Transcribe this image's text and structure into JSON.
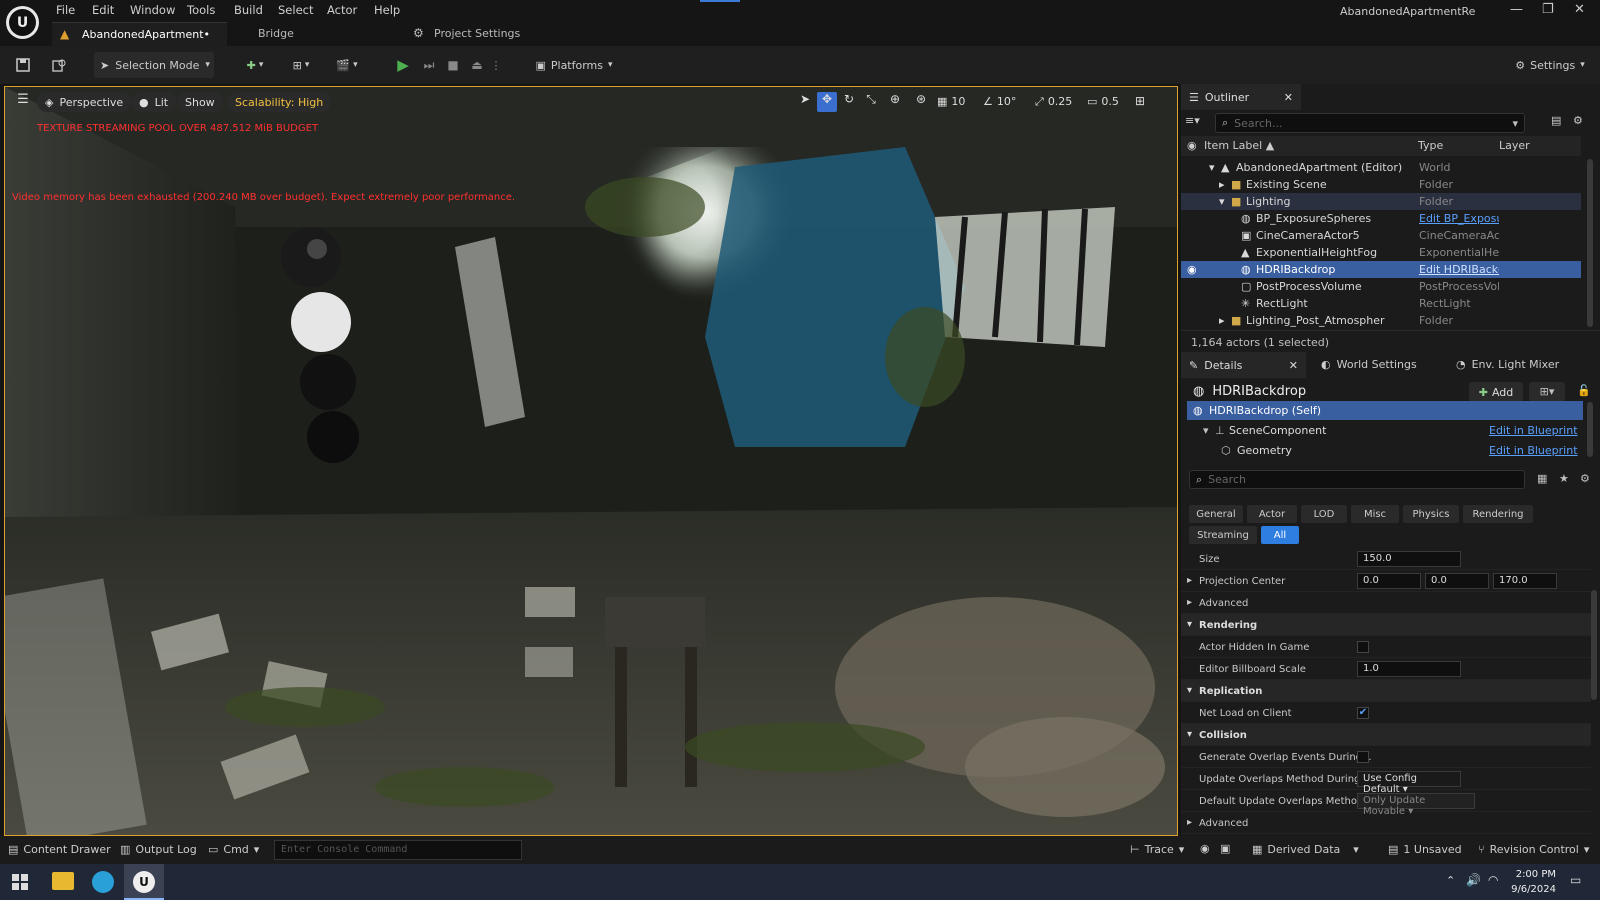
{
  "menu": [
    "File",
    "Edit",
    "Window",
    "Tools",
    "Build",
    "Select",
    "Actor",
    "Help"
  ],
  "project_title": "AbandonedApartmentRe",
  "tabs": {
    "level": "AbandonedApartment•",
    "bridge": "Bridge",
    "project_settings": "Project Settings"
  },
  "toolbar": {
    "selection_mode": "Selection Mode",
    "platforms": "Platforms",
    "settings": "Settings"
  },
  "viewport": {
    "perspective": "Perspective",
    "lit": "Lit",
    "show": "Show",
    "scalability": "Scalability: High",
    "warning1": "TEXTURE STREAMING POOL OVER 487.512 MiB BUDGET",
    "warning2": "Video memory has been exhausted (200.240 MB over budget). Expect extremely poor performance.",
    "grid_snap": "10",
    "rot_snap": "10°",
    "scale_snap": "0.25",
    "cam_speed": "0.5"
  },
  "outliner": {
    "tab": "Outliner",
    "search_placeholder": "Search...",
    "col_label": "Item Label ▲",
    "col_type": "Type",
    "col_layer": "Layer",
    "rows": [
      {
        "label": "AbandonedApartment (Editor)",
        "type": "World"
      },
      {
        "label": "Existing Scene",
        "type": "Folder"
      },
      {
        "label": "Lighting",
        "type": "Folder"
      },
      {
        "label": "BP_ExposureSpheres",
        "type": "Edit BP_Exposur"
      },
      {
        "label": "CineCameraActor5",
        "type": "CineCameraActo"
      },
      {
        "label": "ExponentialHeightFog",
        "type": "ExponentialHeigl"
      },
      {
        "label": "HDRIBackdrop",
        "type": "Edit HDRIBackdı"
      },
      {
        "label": "PostProcessVolume",
        "type": "PostProcessVol"
      },
      {
        "label": "RectLight",
        "type": "RectLight"
      },
      {
        "label": "Lighting_Post_Atmospher",
        "type": "Folder"
      }
    ],
    "status": "1,164 actors (1 selected)"
  },
  "details": {
    "tab_details": "Details",
    "tab_world": "World Settings",
    "tab_env": "Env. Light Mixer",
    "actor_name": "HDRIBackdrop",
    "add_label": "Add",
    "components": [
      {
        "label": "HDRIBackdrop (Self)",
        "action": ""
      },
      {
        "label": "SceneComponent",
        "action": "Edit in Blueprint"
      },
      {
        "label": "Geometry",
        "action": "Edit in Blueprint"
      }
    ],
    "search_placeholder": "Search",
    "categories": [
      "General",
      "Actor",
      "LOD",
      "Misc",
      "Physics",
      "Rendering"
    ],
    "categories2": [
      "Streaming",
      "All"
    ],
    "size_label": "Size",
    "size_value": "150.0",
    "proj_label": "Projection Center",
    "proj_x": "0.0",
    "proj_y": "0.0",
    "proj_z": "170.0",
    "advanced": "Advanced",
    "rendering": "Rendering",
    "hidden_label": "Actor Hidden In Game",
    "billboard_label": "Editor Billboard Scale",
    "billboard_value": "1.0",
    "replication": "Replication",
    "netload_label": "Net Load on Client",
    "collision": "Collision",
    "overlap_label": "Generate Overlap Events During...",
    "update_label": "Update Overlaps Method During...",
    "update_value": "Use Config Default",
    "default_update_label": "Default Update Overlaps Method...",
    "default_update_value": "Only Update Movable",
    "advanced2": "Advanced"
  },
  "bottombar": {
    "content_drawer": "Content Drawer",
    "output_log": "Output Log",
    "cmd": "Cmd",
    "console_placeholder": "Enter Console Command",
    "trace": "Trace",
    "derived_data": "Derived Data",
    "unsaved": "1 Unsaved",
    "revision": "Revision Control"
  },
  "taskbar": {
    "time": "2:00 PM",
    "date": "9/6/2024"
  },
  "colors": {
    "accent": "#3a5fa0",
    "warning": "#ff3030",
    "play": "#4caf50",
    "link": "#5aa0ff",
    "selected_frame": "#e0a030"
  }
}
